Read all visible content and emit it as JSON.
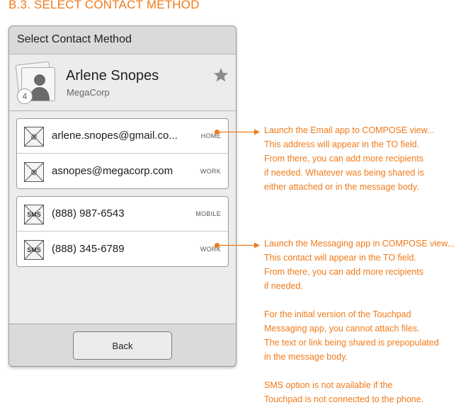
{
  "page": {
    "heading": "B.3. SELECT CONTACT METHOD"
  },
  "dialog": {
    "title": "Select Contact Method",
    "contact": {
      "name": "Arlene Snopes",
      "company": "MegaCorp",
      "count": "4",
      "favorite_icon": "star-icon"
    },
    "email_methods": [
      {
        "icon": "email-icon",
        "glyph": "@",
        "value": "arlene.snopes@gmail.co...",
        "type": "HOME"
      },
      {
        "icon": "email-icon",
        "glyph": "@",
        "value": "asnopes@megacorp.com",
        "type": "WORK"
      }
    ],
    "phone_methods": [
      {
        "icon": "sms-icon",
        "glyph": "SMS",
        "value": "(888) 987-6543",
        "type": "MOBILE"
      },
      {
        "icon": "sms-icon",
        "glyph": "SMS",
        "value": "(888) 345-6789",
        "type": "WORK"
      }
    ],
    "back_label": "Back"
  },
  "annotations": {
    "email": [
      "Launch the Email app to COMPOSE view...",
      "This address will appear in the TO field.",
      "From there, you can add more recipients",
      "if needed. Whatever was being shared is",
      "either attached or in the message body."
    ],
    "sms": [
      "Launch the Messaging app in COMPOSE view...",
      "This contact will appear in the TO field.",
      "From there, you can add more recipients",
      "if needed."
    ],
    "sms_note": [
      "For the initial version of the Touchpad",
      "Messaging app, you cannot attach files.",
      "The text or link being shared is prepopulated",
      "in the message body."
    ],
    "sms_availability": [
      "SMS option is not available if the",
      "Touchpad is not connected to the phone."
    ]
  },
  "colors": {
    "accent": "#f07a1a",
    "panel": "#ececec",
    "header": "#dadada"
  }
}
